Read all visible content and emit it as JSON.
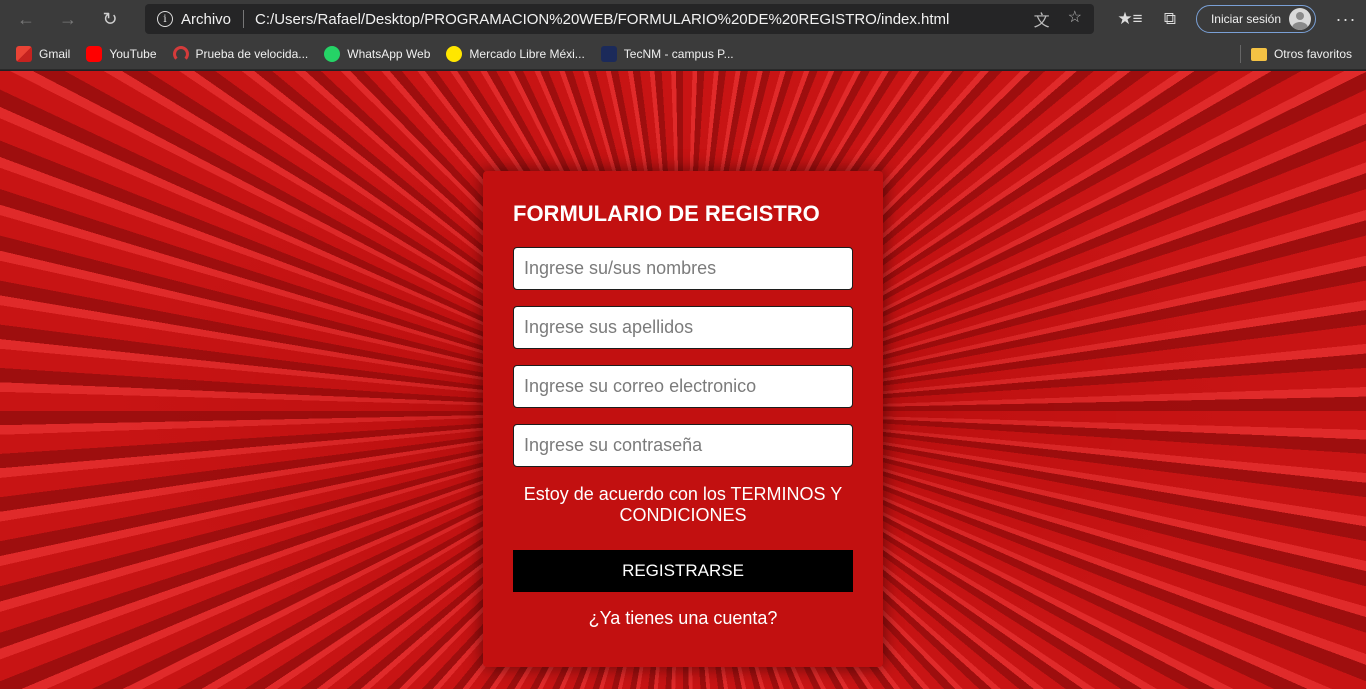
{
  "browser": {
    "address": {
      "scheme_label": "Archivo",
      "url": "C:/Users/Rafael/Desktop/PROGRAMACION%20WEB/FORMULARIO%20DE%20REGISTRO/index.html"
    },
    "signin_label": "Iniciar sesión",
    "icons": {
      "back": "back-arrow-icon",
      "forward": "forward-arrow-icon",
      "reload": "reload-icon",
      "info": "info-icon",
      "translate": "translate-icon",
      "favorite": "star-icon",
      "favorites_list": "favorites-icon",
      "collections": "collections-icon",
      "more": "more-icon"
    }
  },
  "bookmarks": {
    "items": [
      {
        "label": "Gmail"
      },
      {
        "label": "YouTube"
      },
      {
        "label": "Prueba de velocida..."
      },
      {
        "label": "WhatsApp Web"
      },
      {
        "label": "Mercado Libre Méxi..."
      },
      {
        "label": "TecNM - campus P..."
      }
    ],
    "other_label": "Otros favoritos"
  },
  "form": {
    "title": "FORMULARIO DE REGISTRO",
    "fields": [
      {
        "placeholder": "Ingrese su/sus nombres"
      },
      {
        "placeholder": "Ingrese sus apellidos"
      },
      {
        "placeholder": "Ingrese su correo electronico"
      },
      {
        "placeholder": "Ingrese su contraseña"
      }
    ],
    "terms": "Estoy de acuerdo con los TERMINOS Y CONDICIONES",
    "submit_label": "REGISTRARSE",
    "login_link": "¿Ya tienes una cuenta?"
  },
  "colors": {
    "card": "#c21010",
    "background": "#c81414",
    "button": "#000000"
  }
}
